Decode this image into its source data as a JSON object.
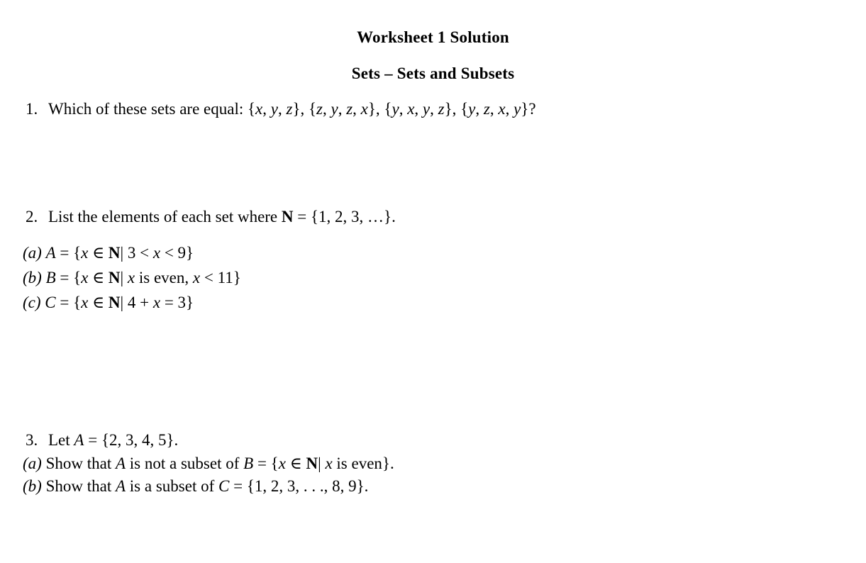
{
  "document": {
    "title": "Worksheet 1 Solution",
    "subtitle": "Sets – Sets and Subsets"
  },
  "questions": [
    {
      "number": "1.",
      "text": "Which of these sets are equal: {x, y, z}, {z, y, z, x}, {y, x, y, z}, {y, z, x, y}?",
      "parts": []
    },
    {
      "number": "2.",
      "text": "List the elements of each set where N = {1, 2, 3, …}.",
      "parts": [
        {
          "label": "(a)",
          "text": "A = {x ∈ N| 3 < x < 9}"
        },
        {
          "label": "(b)",
          "text": "B = {x ∈ N| x is even, x < 11}"
        },
        {
          "label": "(c)",
          "text": "C = {x ∈ N| 4 + x = 3}"
        }
      ]
    },
    {
      "number": "3.",
      "text": "Let A = {2, 3, 4, 5}.",
      "parts": [
        {
          "label": "(a)",
          "text": "Show that A is not a subset of B = {x ∈ N| x is even}."
        },
        {
          "label": "(b)",
          "text": "Show that A is a subset of C = {1, 2, 3, . . ., 8, 9}."
        }
      ]
    }
  ],
  "segments": {
    "q1": {
      "num": "1.",
      "lead": "Which of these sets are equal: {",
      "s1_x": "x",
      "c1": ", ",
      "s1_y": "y",
      "c2": ", ",
      "s1_z": "z",
      "b1": "}, {",
      "s2_z": "z",
      "c3": ", ",
      "s2_y": "y",
      "c4": ", ",
      "s2_z2": "z",
      "c5": ", ",
      "s2_x": "x",
      "b2": "}, {",
      "s3_y": "y",
      "c6": ", ",
      "s3_x": "x",
      "c7": ", ",
      "s3_y2": "y",
      "c8": ", ",
      "s3_z": "z",
      "b3": "}, {",
      "s4_y": "y",
      "c9": ", ",
      "s4_z": "z",
      "c10": ", ",
      "s4_x": "x",
      "c11": ", ",
      "s4_y2": "y",
      "tail": "}?"
    },
    "q2": {
      "num": "2.",
      "lead": "List the elements of each set where ",
      "setN": "N",
      "tail": " = {1, 2, 3, …}."
    },
    "q2a": {
      "label": "(a)",
      "var": "A",
      "eq": " = {",
      "x1": "x",
      "in": " ∈ ",
      "setN": "N",
      "bar": "| 3 < ",
      "x2": "x",
      "tail": " < 9}"
    },
    "q2b": {
      "label": "(b)",
      "var": "B",
      "eq": " = {",
      "x1": "x",
      "in": " ∈ ",
      "setN": "N",
      "bar": "| ",
      "x2": "x",
      "mid": " is even, ",
      "x3": "x",
      "tail": " < 11}"
    },
    "q2c": {
      "label": "(c)",
      "var": "C",
      "eq": " = {",
      "x1": "x",
      "in": " ∈ ",
      "setN": "N",
      "bar": "| 4 + ",
      "x2": "x",
      "tail": " = 3}"
    },
    "q3": {
      "num": "3.",
      "lead": "Let ",
      "var": "A",
      "tail": " = {2, 3, 4, 5}."
    },
    "q3a": {
      "label": "(a)",
      "lead": "Show that ",
      "varA": "A",
      "mid": " is not a subset of ",
      "varB": "B",
      "eq": " = {",
      "x1": "x",
      "in": " ∈ ",
      "setN": "N",
      "bar": "| ",
      "x2": "x",
      "tail": " is even}."
    },
    "q3b": {
      "label": "(b)",
      "lead": "Show that ",
      "varA": "A",
      "mid": " is a subset of ",
      "varC": "C",
      "tail": " = {1, 2, 3, . . ., 8, 9}."
    }
  },
  "colors": {
    "page_background": "#ffffff",
    "text": "#000000"
  }
}
